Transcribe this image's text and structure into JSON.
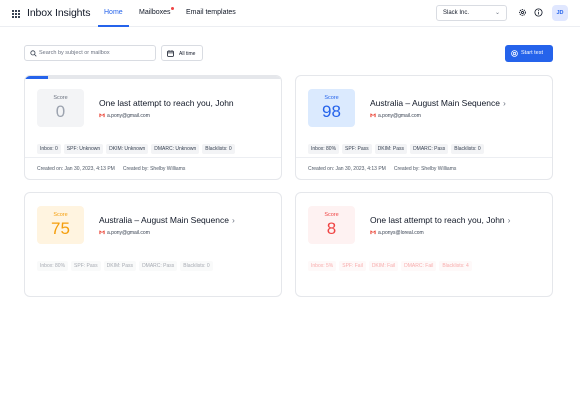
{
  "app": {
    "title": "Inbox Insights",
    "apps_icon": "grid-icon"
  },
  "nav": {
    "home": "Home",
    "mailboxes": "Mailboxes",
    "email_templates": "Email templates"
  },
  "workspace": {
    "selected": "Slack Inc.",
    "icon": "chevron-down-icon"
  },
  "user": {
    "initials": "JD"
  },
  "search": {
    "placeholder": "Search by subject or mailbox",
    "value": ""
  },
  "date_filter": {
    "label": "All time"
  },
  "actions": {
    "start_test": "Start test"
  },
  "colors": {
    "accent": "#2563eb",
    "score_gray": "#9ca3af",
    "score_blue": "#2563eb",
    "score_orange": "#f59e0b",
    "score_red": "#ef4444",
    "notification_dot": "#ef4444"
  },
  "cards": [
    {
      "tone": "gray",
      "progress": 0.09,
      "score_label": "Score",
      "score": "0",
      "title": "One last attempt to reach you, John",
      "has_arrow": false,
      "sender": "a.pony@gmail.com",
      "chips": [
        "Inbox: 0",
        "SPF: Unknown",
        "DKIM: Unknown",
        "DMARC: Unknown",
        "Blacklists: 0"
      ],
      "created_on": "Created on: Jan 30, 2023, 4:13 PM",
      "created_by": "Created by: Shelby Williams"
    },
    {
      "tone": "blue",
      "score_label": "Score",
      "score": "98",
      "title": "Australia – August Main Sequence",
      "has_arrow": true,
      "sender": "a.pony@gmail.com",
      "chips": [
        "Inbox: 80%",
        "SPF: Pass",
        "DKIM: Pass",
        "DMARC: Pass",
        "Blacklists: 0"
      ],
      "created_on": "Created on: Jan 30, 2023, 4:13 PM",
      "created_by": "Created by: Shelby Williams"
    },
    {
      "tone": "orange",
      "score_label": "Score",
      "score": "75",
      "title": "Australia – August Main Sequence",
      "has_arrow": true,
      "sender": "a.pony@gmail.com",
      "chips": [
        "Inbox: 80%",
        "SPF: Pass",
        "DKIM: Pass",
        "DMARC: Pass",
        "Blacklists: 0"
      ],
      "created_on": "",
      "created_by": ""
    },
    {
      "tone": "red",
      "score_label": "Score",
      "score": "8",
      "title": "One last attempt to reach you, John",
      "has_arrow": true,
      "sender": "a.ponys@loreal.com",
      "chips": [
        "Inbox: 5%",
        "SPF: Fail",
        "DKIM: Fail",
        "DMARC: Fail",
        "Blacklists: 4"
      ],
      "created_on": "",
      "created_by": ""
    }
  ]
}
